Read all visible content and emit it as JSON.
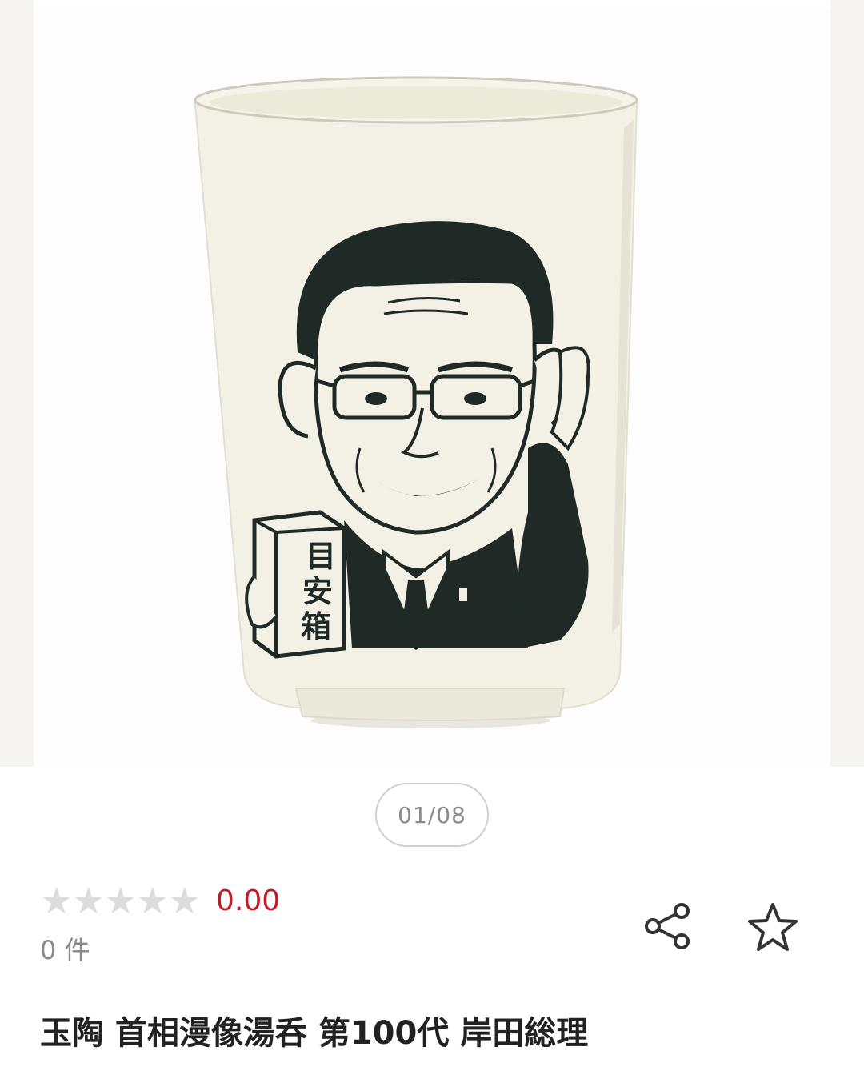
{
  "gallery": {
    "counter": "01/08",
    "current": 1,
    "total": 8
  },
  "product_image": {
    "box_label": "目安箱"
  },
  "rating": {
    "stars_max": 5,
    "stars_filled": 0,
    "value": "0.00",
    "count_text": "0 件"
  },
  "actions": {
    "share_icon": "share-icon",
    "favorite_icon": "star-outline-icon"
  },
  "product": {
    "title": "玉陶 首相漫像湯呑 第100代 岸田総理"
  },
  "colors": {
    "rating_value": "#c01c28",
    "star_empty": "#dcdcdc",
    "ink": "#1f2a27",
    "cup": "#f3f1e6"
  }
}
